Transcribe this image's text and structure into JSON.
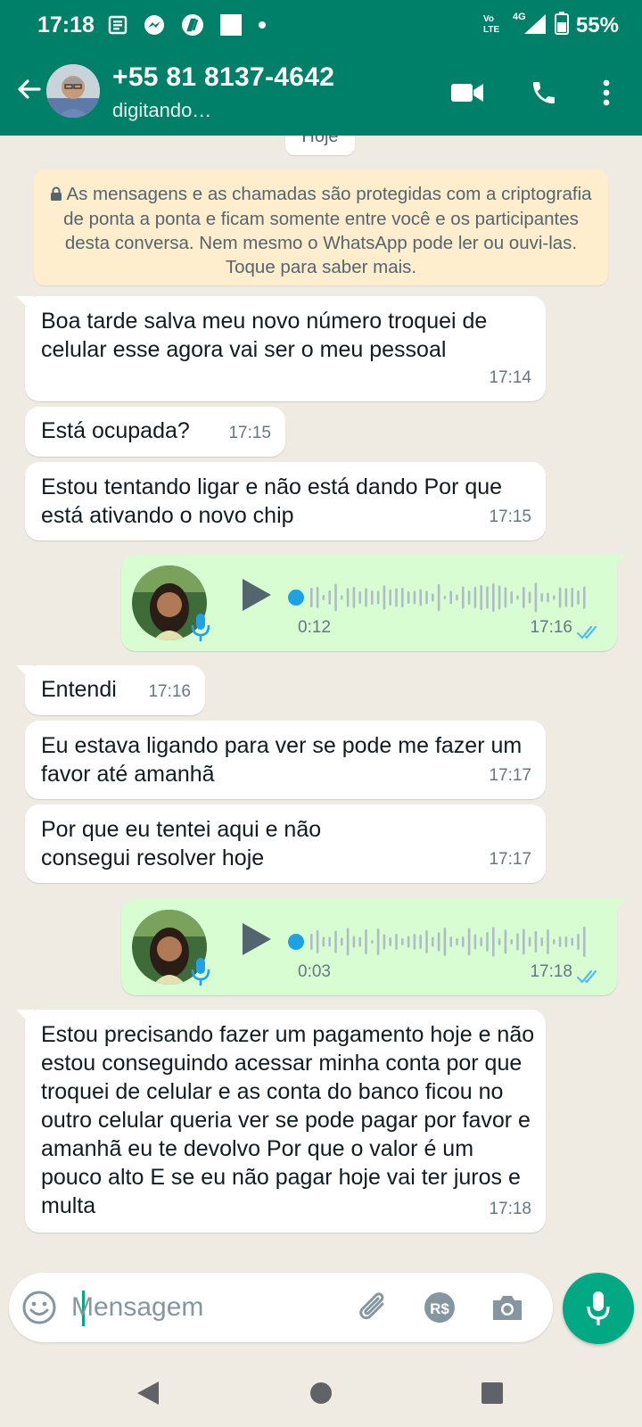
{
  "status_bar": {
    "time": "17:18",
    "network": "4G",
    "volte": "Vo LTE",
    "battery": "55%"
  },
  "header": {
    "contact_name": "+55 81 8137-4642",
    "contact_status": "digitando…",
    "icons": [
      "back-arrow-icon",
      "video-call-icon",
      "phone-icon",
      "more-icon"
    ]
  },
  "chat": {
    "day_label": "Hoje",
    "encryption_notice": "As mensagens e as chamadas são protegidas com a criptografia de ponta a ponta e ficam somente entre você e os participantes desta conversa. Nem mesmo o WhatsApp pode ler ou ouvi-las. Toque para saber mais.",
    "messages": [
      {
        "dir": "in",
        "text": "Boa tarde salva meu novo número troquei de celular esse agora vai ser o meu pessoal",
        "time": "17:14"
      },
      {
        "dir": "in",
        "text": "Está ocupada?",
        "time": "17:15"
      },
      {
        "dir": "in",
        "text": "Estou tentando ligar e não está dando Por que está ativando o novo chip",
        "time": "17:15"
      },
      {
        "dir": "out",
        "type": "voice",
        "duration": "0:12",
        "time": "17:16",
        "status": "read"
      },
      {
        "dir": "in",
        "text": "Entendi",
        "time": "17:16"
      },
      {
        "dir": "in",
        "text": "Eu estava ligando para ver se pode me fazer um favor até amanhã",
        "time": "17:17"
      },
      {
        "dir": "in",
        "text": "Por que eu tentei aqui e não consegui resolver hoje",
        "time": "17:17"
      },
      {
        "dir": "out",
        "type": "voice",
        "duration": "0:03",
        "time": "17:18",
        "status": "read"
      },
      {
        "dir": "in",
        "text": "Estou precisando fazer um pagamento hoje e não estou conseguindo acessar minha conta por que troquei de celular e as conta do banco ficou no outro celular queria ver se pode pagar por favor e amanhã eu te devolvo Por que o valor é um pouco alto E se eu não pagar hoje vai ter juros e multa",
        "time": "17:18"
      }
    ]
  },
  "input": {
    "placeholder": "Mensagem"
  },
  "colors": {
    "header": "#008069",
    "chat_bg": "#efeae2",
    "outgoing": "#d9fdd3",
    "accent": "#00a884",
    "read_ticks": "#53bdeb",
    "notice_bg": "#ffeecd"
  }
}
